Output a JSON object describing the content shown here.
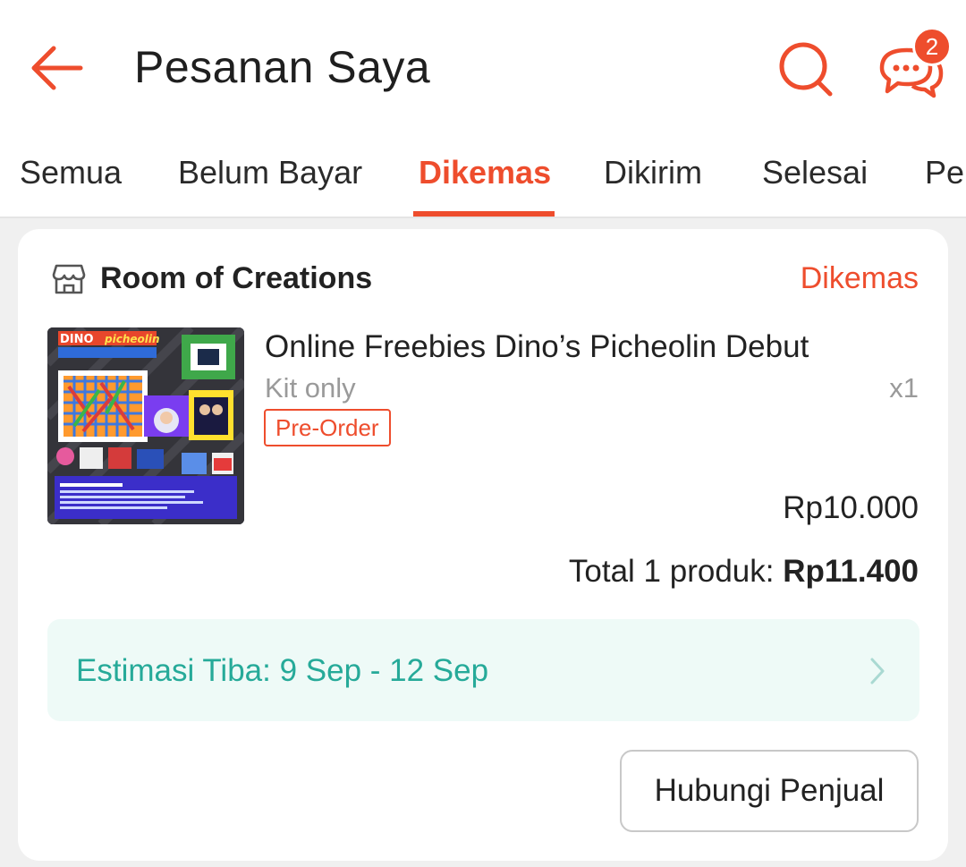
{
  "header": {
    "title": "Pesanan Saya",
    "chat_badge_count": "2",
    "back_icon": "arrow-left-icon",
    "search_icon": "search-icon",
    "chat_icon": "chat-icon",
    "accent_color": "#ee4d2d"
  },
  "tabs": [
    {
      "label": "Semua",
      "active": false
    },
    {
      "label": "Belum Bayar",
      "active": false
    },
    {
      "label": "Dikemas",
      "active": true
    },
    {
      "label": "Dikirim",
      "active": false
    },
    {
      "label": "Selesai",
      "active": false
    },
    {
      "label": "Pe",
      "active": false
    }
  ],
  "order": {
    "shop_name": "Room of Creations",
    "shop_icon": "store-icon",
    "status": "Dikemas",
    "product": {
      "thumb_text_top_left": "DINO",
      "thumb_text_top_right": "picheolin",
      "title": "Online Freebies Dino’s Picheolin Debut",
      "variant": "Kit only",
      "quantity": "x1",
      "tag": "Pre-Order",
      "price": "Rp10.000"
    },
    "total_label": "Total 1 produk: ",
    "total_amount": "Rp11.400",
    "eta": {
      "text": "Estimasi Tiba: 9 Sep - 12 Sep",
      "color": "#26aa99",
      "icon": "chevron-right-icon"
    },
    "contact_button": "Hubungi Penjual"
  }
}
